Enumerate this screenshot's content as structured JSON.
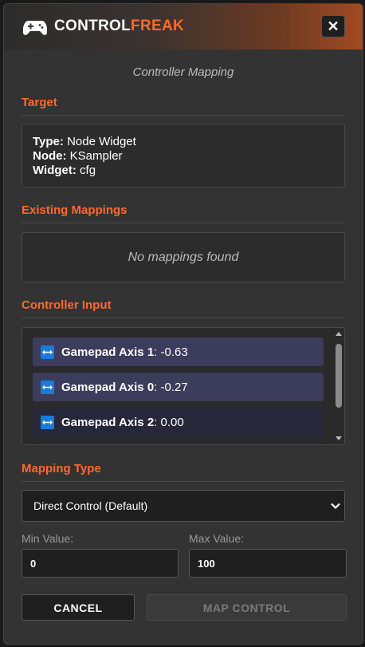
{
  "header": {
    "title_part1": "CONTROL",
    "title_part2": "FREAK",
    "close_label": "✕",
    "accent_color": "#ff6a2b"
  },
  "subtitle": "Controller Mapping",
  "target": {
    "section_title": "Target",
    "type_label": "Type:",
    "type_value": "Node Widget",
    "node_label": "Node:",
    "node_value": "KSampler",
    "widget_label": "Widget:",
    "widget_value": "cfg"
  },
  "existing": {
    "section_title": "Existing Mappings",
    "empty_text": "No mappings found"
  },
  "controller_input": {
    "section_title": "Controller Input",
    "items": [
      {
        "name": "Gamepad Axis 1",
        "value": ": -0.63",
        "icon": "axis-arrows-icon"
      },
      {
        "name": "Gamepad Axis 0",
        "value": ": -0.27",
        "icon": "axis-arrows-icon"
      },
      {
        "name": "Gamepad Axis 2",
        "value": ": 0.00",
        "icon": "axis-arrows-icon"
      }
    ]
  },
  "mapping_type": {
    "section_title": "Mapping Type",
    "selected": "Direct Control (Default)"
  },
  "min_value": {
    "label": "Min Value:",
    "value": "0"
  },
  "max_value": {
    "label": "Max Value:",
    "value": "100"
  },
  "buttons": {
    "cancel": "CANCEL",
    "map": "MAP CONTROL"
  }
}
